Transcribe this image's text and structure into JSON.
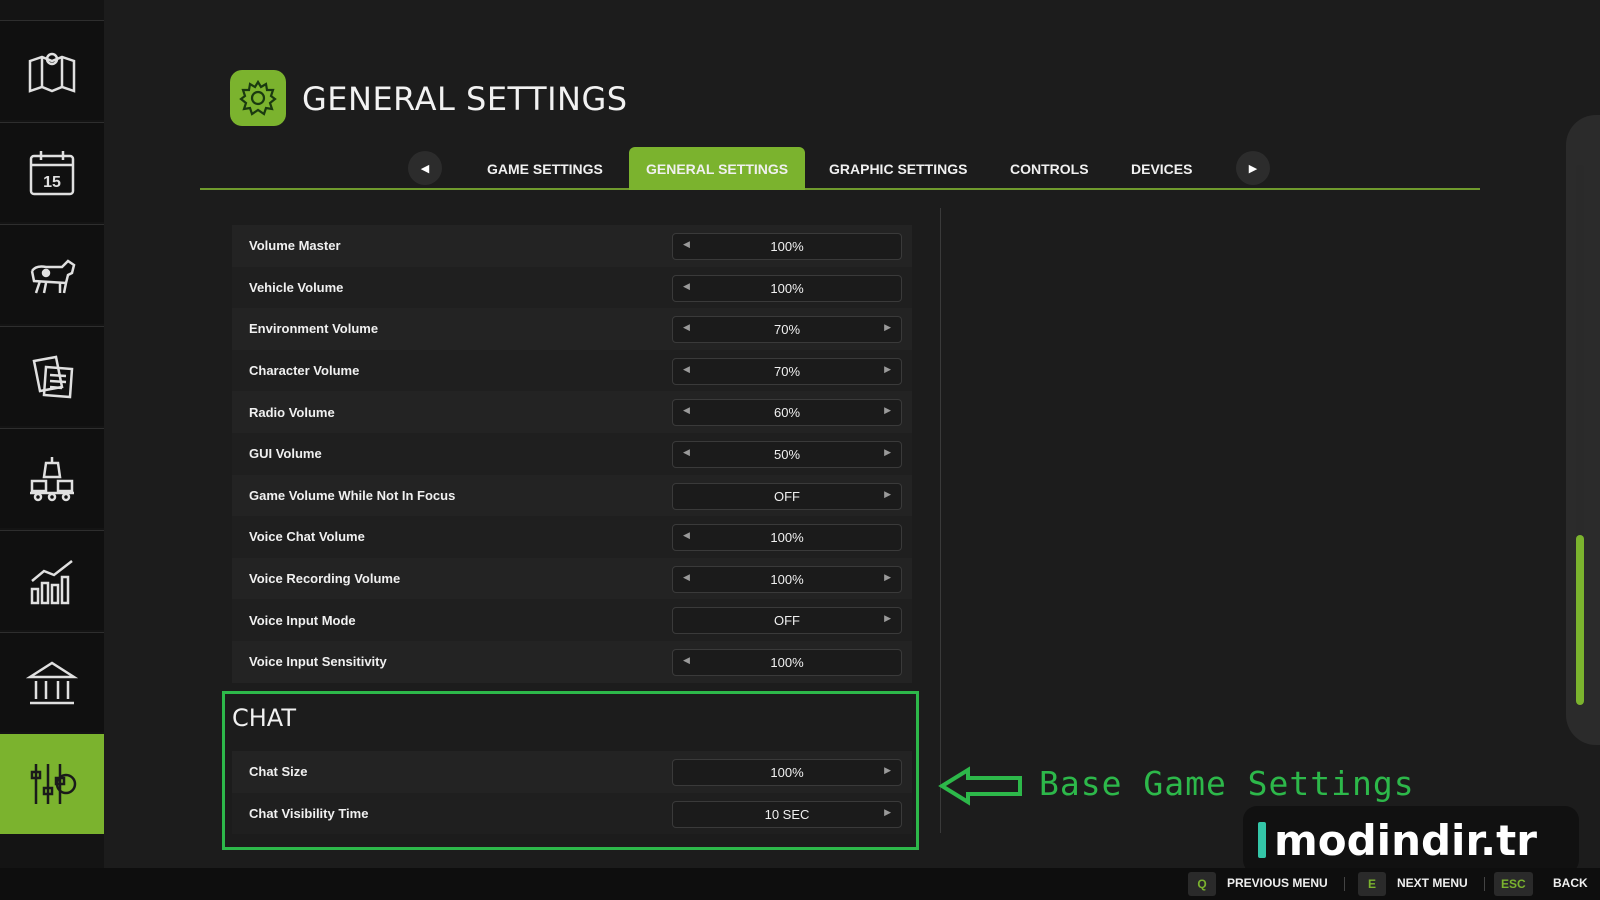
{
  "sidebar": {
    "items": [
      {
        "icon": "map-icon"
      },
      {
        "icon": "calendar-icon",
        "icon_text": "15"
      },
      {
        "icon": "cow-icon"
      },
      {
        "icon": "contracts-icon"
      },
      {
        "icon": "production-icon"
      },
      {
        "icon": "statistics-icon"
      },
      {
        "icon": "bank-icon"
      },
      {
        "icon": "settings-sliders-icon",
        "active": true
      }
    ]
  },
  "header": {
    "title": "GENERAL SETTINGS",
    "icon": "gear-icon"
  },
  "tabs": {
    "items": [
      "GAME SETTINGS",
      "GENERAL SETTINGS",
      "GRAPHIC SETTINGS",
      "CONTROLS",
      "DEVICES"
    ],
    "active": "GENERAL SETTINGS"
  },
  "settings": [
    {
      "label": "Volume Master",
      "value": "100%"
    },
    {
      "label": "Vehicle Volume",
      "value": "100%"
    },
    {
      "label": "Environment Volume",
      "value": "70%"
    },
    {
      "label": "Character Volume",
      "value": "70%"
    },
    {
      "label": "Radio Volume",
      "value": "60%"
    },
    {
      "label": "GUI Volume",
      "value": "50%"
    },
    {
      "label": "Game Volume While Not In Focus",
      "value": "OFF"
    },
    {
      "label": "Voice Chat Volume",
      "value": "100%"
    },
    {
      "label": "Voice Recording Volume",
      "value": "100%"
    },
    {
      "label": "Voice Input Mode",
      "value": "OFF"
    },
    {
      "label": "Voice Input Sensitivity",
      "value": "100%"
    }
  ],
  "chat": {
    "title": "CHAT",
    "settings": [
      {
        "label": "Chat Size",
        "value": "100%"
      },
      {
        "label": "Chat Visibility Time",
        "value": "10 SEC"
      }
    ]
  },
  "annotation": {
    "text": "Base Game Settings",
    "color": "#2db84a"
  },
  "watermark": {
    "text": "modindir.tr"
  },
  "footer": {
    "actions": [
      {
        "key": "Q",
        "label": "PREVIOUS MENU"
      },
      {
        "key": "E",
        "label": "NEXT MENU"
      },
      {
        "key": "ESC",
        "label": "BACK"
      }
    ]
  },
  "colors": {
    "accent": "#7bb32e",
    "annotation": "#2db84a",
    "background": "#1c1c1c"
  }
}
